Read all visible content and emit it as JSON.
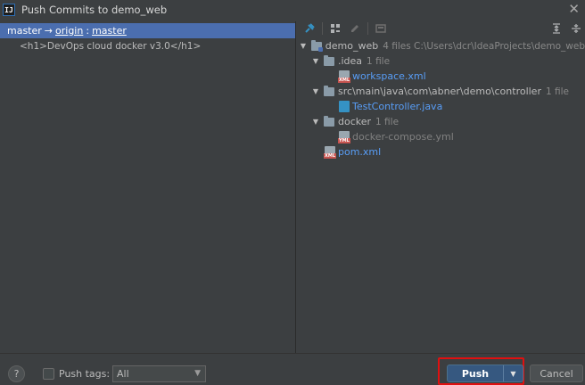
{
  "window": {
    "title": "Push Commits to demo_web",
    "app_icon_text": "IJ"
  },
  "left": {
    "branch": {
      "local": "master",
      "arrow": "→",
      "remote": "origin",
      "separator": ":",
      "remote_branch": "master"
    },
    "commits": [
      {
        "message": "<h1>DevOps cloud docker v3.0</h1>"
      }
    ]
  },
  "toolbar": {
    "icons": [
      "pin-icon",
      "group-by-icon",
      "edit-source-icon",
      "diff-icon",
      "expand-all-icon",
      "collapse-all-icon"
    ]
  },
  "tree": {
    "root": {
      "name": "demo_web",
      "meta": "4 files  C:\\Users\\dcr\\IdeaProjects\\demo_web"
    },
    "idea": {
      "name": ".idea",
      "meta": "1 file"
    },
    "workspace": {
      "name": "workspace.xml",
      "tag": "XML"
    },
    "src": {
      "name": "src\\main\\java\\com\\abner\\demo\\controller",
      "meta": "1 file"
    },
    "testcontroller": {
      "name": "TestController.java"
    },
    "docker": {
      "name": "docker",
      "meta": "1 file"
    },
    "compose": {
      "name": "docker-compose.yml",
      "tag": "YML"
    },
    "pom": {
      "name": "pom.xml",
      "tag": "XML"
    }
  },
  "bottom": {
    "help_label": "?",
    "push_tags_label": "Push tags:",
    "push_tags_value": "All",
    "push_label": "Push",
    "cancel_label": "Cancel"
  },
  "colors": {
    "accent": "#4b6eaf",
    "link": "#589df6",
    "highlight": "#e01010",
    "push_button": "#365880"
  }
}
